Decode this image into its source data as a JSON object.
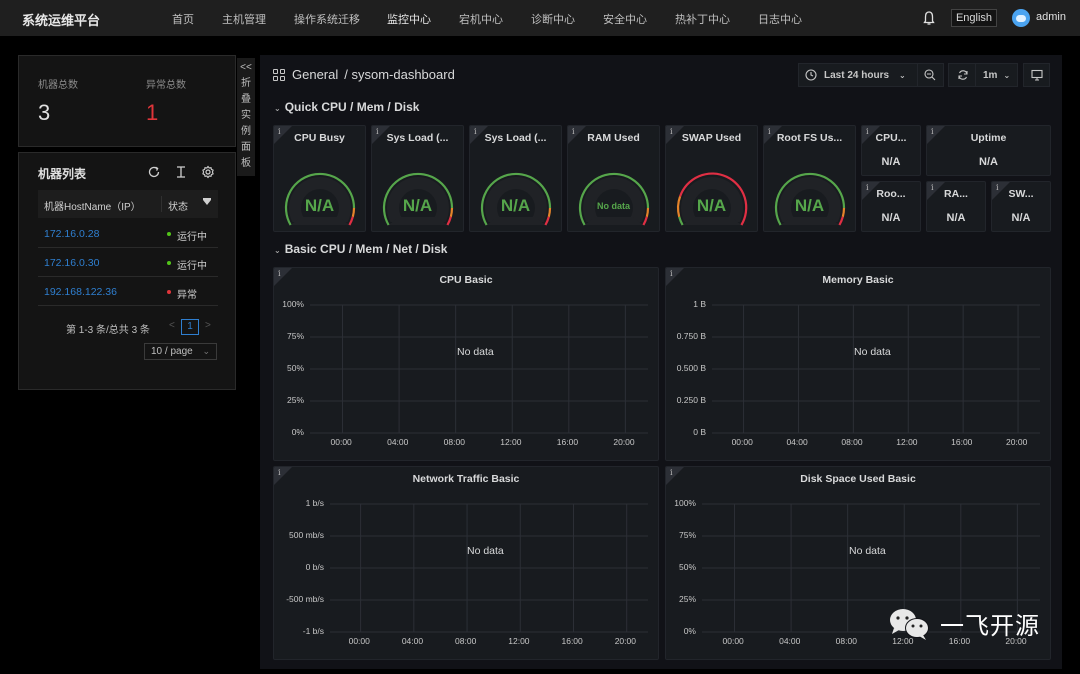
{
  "topbar": {
    "brand": "系统运维平台",
    "nav": [
      {
        "label": "首页",
        "active": false
      },
      {
        "label": "主机管理",
        "active": false
      },
      {
        "label": "操作系统迁移",
        "active": false
      },
      {
        "label": "监控中心",
        "active": true
      },
      {
        "label": "宕机中心",
        "active": false
      },
      {
        "label": "诊断中心",
        "active": false
      },
      {
        "label": "安全中心",
        "active": false
      },
      {
        "label": "热补丁中心",
        "active": false
      },
      {
        "label": "日志中心",
        "active": false
      }
    ],
    "language": "English",
    "username": "admin",
    "icons": {
      "notification": "bell-icon",
      "avatar": "user-avatar"
    }
  },
  "summary": {
    "total_label": "机器总数",
    "total_value": "3",
    "abnormal_label": "异常总数",
    "abnormal_value": "1"
  },
  "collapse_tab": {
    "arrow": "<<",
    "chars": [
      "折",
      "叠",
      "实",
      "例",
      "面",
      "板"
    ]
  },
  "machine_list": {
    "title": "机器列表",
    "tools": [
      {
        "name": "refresh-icon",
        "glyph": "↻"
      },
      {
        "name": "column-height-icon",
        "glyph": "Ī"
      },
      {
        "name": "settings-icon",
        "glyph": "⚙"
      }
    ],
    "columns": {
      "host": "机器HostName（IP）",
      "status": "状态"
    },
    "rows": [
      {
        "ip": "172.16.0.28",
        "status": "运行中",
        "status_color": "#52c41a"
      },
      {
        "ip": "172.16.0.30",
        "status": "运行中",
        "status_color": "#52c41a"
      },
      {
        "ip": "192.168.122.36",
        "status": "异常",
        "status_color": "#e0353a"
      }
    ],
    "pagination": {
      "summary": "第 1-3 条/总共 3 条",
      "prev": "<",
      "current": "1",
      "next": ">",
      "page_size": "10 / page"
    }
  },
  "dashboard": {
    "folder": "General",
    "name": "/ sysom-dashboard",
    "time_range": "Last 24 hours",
    "refresh_interval": "1m",
    "rows": [
      {
        "title": "Quick CPU / Mem / Disk"
      },
      {
        "title": "Basic CPU / Mem / Net / Disk"
      }
    ],
    "gauges": [
      {
        "title": "CPU Busy",
        "value": "N/A",
        "scheme": "green"
      },
      {
        "title": "Sys Load (...",
        "value": "N/A",
        "scheme": "green"
      },
      {
        "title": "Sys Load (...",
        "value": "N/A",
        "scheme": "green"
      },
      {
        "title": "RAM Used",
        "value": "No data",
        "scheme": "green"
      },
      {
        "title": "SWAP Used",
        "value": "N/A",
        "scheme": "red"
      },
      {
        "title": "Root FS Us...",
        "value": "N/A",
        "scheme": "green"
      }
    ],
    "stats": [
      {
        "title": "CPU...",
        "value": "N/A"
      },
      {
        "title": "Uptime",
        "value": "N/A"
      },
      {
        "title": "Roo...",
        "value": "N/A"
      },
      {
        "title": "RA...",
        "value": "N/A"
      },
      {
        "title": "SW...",
        "value": "N/A"
      }
    ],
    "colors": {
      "ok": "#56a64b",
      "warn": "#e5842a",
      "crit": "#e02f44"
    }
  },
  "chart_data": [
    {
      "type": "line",
      "title": "CPU Basic",
      "x": [
        "00:00",
        "04:00",
        "08:00",
        "12:00",
        "16:00",
        "20:00"
      ],
      "y_ticks": [
        "100%",
        "75%",
        "50%",
        "25%",
        "0%"
      ],
      "ylim": [
        0,
        100
      ],
      "series": [],
      "annotation": "No data",
      "grid": true
    },
    {
      "type": "line",
      "title": "Memory Basic",
      "x": [
        "00:00",
        "04:00",
        "08:00",
        "12:00",
        "16:00",
        "20:00"
      ],
      "y_ticks": [
        "1 B",
        "0.750 B",
        "0.500 B",
        "0.250 B",
        "0 B"
      ],
      "ylim": [
        0,
        1
      ],
      "series": [],
      "annotation": "No data",
      "grid": true
    },
    {
      "type": "line",
      "title": "Network Traffic Basic",
      "x": [
        "00:00",
        "04:00",
        "08:00",
        "12:00",
        "16:00",
        "20:00"
      ],
      "y_ticks": [
        "1 b/s",
        "500 mb/s",
        "0 b/s",
        "-500 mb/s",
        "-1 b/s"
      ],
      "ylim": [
        -1,
        1
      ],
      "series": [],
      "annotation": "No data",
      "grid": true
    },
    {
      "type": "line",
      "title": "Disk Space Used Basic",
      "x": [
        "00:00",
        "04:00",
        "08:00",
        "12:00",
        "16:00",
        "20:00"
      ],
      "y_ticks": [
        "100%",
        "75%",
        "50%",
        "25%",
        "0%"
      ],
      "ylim": [
        0,
        100
      ],
      "series": [],
      "annotation": "No data",
      "grid": true
    }
  ],
  "watermark": {
    "text": "一飞开源"
  }
}
